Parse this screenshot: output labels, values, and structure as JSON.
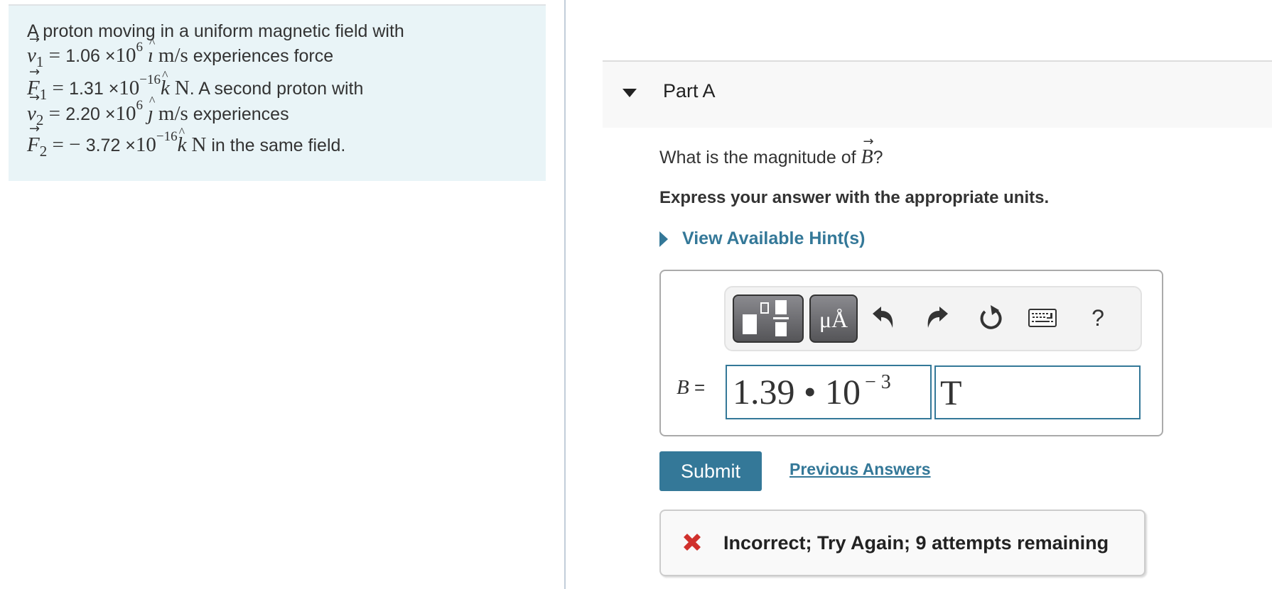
{
  "problem": {
    "line1": "A proton moving in a uniform magnetic field with",
    "v1": {
      "symbol": "v",
      "subscript": "1",
      "equals": " = ",
      "mantissa": "1.06",
      "times": " ×",
      "base": "10",
      "exponent": "6",
      "unit_vector": "ı",
      "unit": "m/s",
      "tail": " experiences force"
    },
    "f1": {
      "symbol": "F",
      "subscript": "1",
      "equals": " = ",
      "mantissa": "1.31",
      "times": " ×",
      "base": "10",
      "exponent": "−16",
      "unit_vector": "k",
      "unit": "N",
      "tail": ". A second proton with"
    },
    "v2": {
      "symbol": "v",
      "subscript": "2",
      "equals": " = ",
      "mantissa": "2.20",
      "times": " ×",
      "base": "10",
      "exponent": "6",
      "unit_vector": "ȷ",
      "unit": "m/s",
      "tail": " experiences"
    },
    "f2": {
      "symbol": "F",
      "subscript": "2",
      "equals": " = − ",
      "mantissa": "3.72",
      "times": " ×",
      "base": "10",
      "exponent": "−16",
      "unit_vector": "k",
      "unit": "N",
      "tail": " in the same field."
    }
  },
  "part": {
    "title": "Part A",
    "caret_icon": "caret-down-icon"
  },
  "question": {
    "prefix": "What is the magnitude of ",
    "symbol": "B",
    "suffix": "?"
  },
  "instructions": "Express your answer with the appropriate units.",
  "hint": {
    "label": "View Available Hint(s)",
    "icon": "caret-right-icon"
  },
  "toolbar": {
    "template_icon": "templates-icon",
    "units_label": "μÅ",
    "undo_icon": "undo-icon",
    "redo_icon": "redo-icon",
    "reset_icon": "reset-icon",
    "keyboard_icon": "keyboard-icon",
    "help_label": "?"
  },
  "answer": {
    "variable": "B",
    "equals": " =",
    "value_mantissa": "1.39",
    "value_dot": " • ",
    "value_base": "10",
    "value_exponent": "− 3",
    "unit": "T"
  },
  "actions": {
    "submit_label": "Submit",
    "previous_answers_label": "Previous Answers"
  },
  "feedback": {
    "status": "incorrect",
    "icon": "x-mark-icon",
    "message": "Incorrect; Try Again; 9 attempts remaining",
    "icon_color": "#d0312d"
  },
  "colors": {
    "accent": "#347898",
    "problem_bg": "#e9f4f7",
    "error": "#d0312d"
  }
}
